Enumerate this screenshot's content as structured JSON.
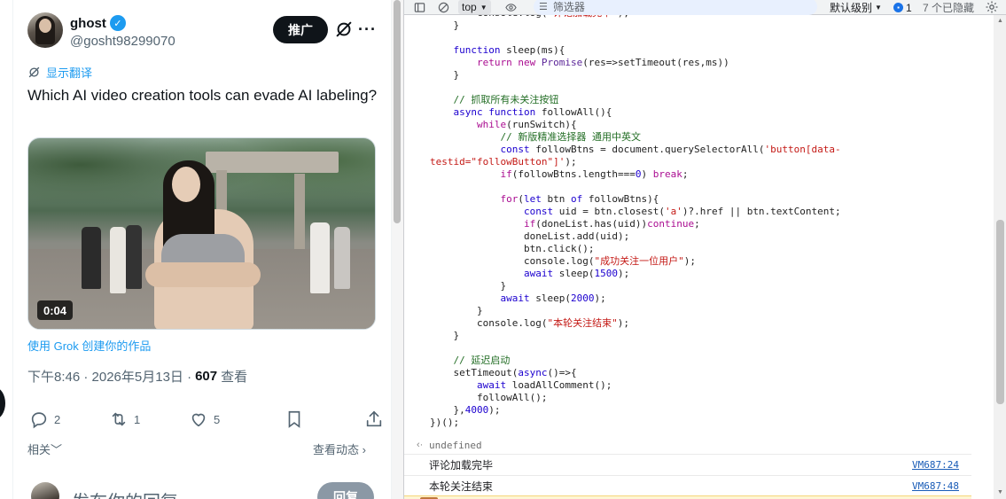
{
  "tweet": {
    "display_name": "ghost",
    "handle": "@gosht98299070",
    "promote_label": "推广",
    "translate_label": "显示翻译",
    "text": "Which AI video creation tools can evade AI labeling?",
    "media": {
      "duration": "0:04"
    },
    "grok_caption": "使用 Grok 创建你的作品",
    "meta": {
      "time": "下午8:46 · 2026年5月13日 · ",
      "views": "607",
      "views_label": "查看"
    },
    "actions": {
      "replies": "2",
      "reposts": "1",
      "likes": "5"
    },
    "related_label": "相关",
    "activity_label": "查看动态",
    "reply": {
      "placeholder": "发布你的回复",
      "button_label": "回复"
    }
  },
  "devtools": {
    "context": "top",
    "filter_placeholder": "筛选器",
    "level_label": "默认级别",
    "issues": "1",
    "hidden": "7 个已隐藏",
    "code_lines": [
      {
        "indent": 2,
        "segments": [
          [
            "plain",
            "console.log("
          ],
          [
            "str",
            "\"评论加载完毕\""
          ],
          [
            "plain",
            ");"
          ]
        ]
      },
      {
        "indent": 1,
        "segments": [
          [
            "plain",
            "}"
          ]
        ]
      },
      {
        "indent": 0,
        "segments": []
      },
      {
        "indent": 1,
        "segments": [
          [
            "kb",
            "function"
          ],
          [
            "plain",
            " sleep(ms){"
          ]
        ]
      },
      {
        "indent": 2,
        "segments": [
          [
            "kw",
            "return"
          ],
          [
            "plain",
            " "
          ],
          [
            "kw",
            "new"
          ],
          [
            "plain",
            " "
          ],
          [
            "ty",
            "Promise"
          ],
          [
            "plain",
            "(res=>setTimeout(res,ms))"
          ]
        ]
      },
      {
        "indent": 1,
        "segments": [
          [
            "plain",
            "}"
          ]
        ]
      },
      {
        "indent": 0,
        "segments": []
      },
      {
        "indent": 1,
        "segments": [
          [
            "cm",
            "// 抓取所有未关注按钮"
          ]
        ]
      },
      {
        "indent": 1,
        "segments": [
          [
            "kb",
            "async"
          ],
          [
            "plain",
            " "
          ],
          [
            "kb",
            "function"
          ],
          [
            "plain",
            " followAll(){"
          ]
        ]
      },
      {
        "indent": 2,
        "segments": [
          [
            "kw",
            "while"
          ],
          [
            "plain",
            "(runSwitch){"
          ]
        ]
      },
      {
        "indent": 3,
        "segments": [
          [
            "cm",
            "// 新版精准选择器 通用中英文"
          ]
        ]
      },
      {
        "indent": 3,
        "segments": [
          [
            "kb",
            "const"
          ],
          [
            "plain",
            " followBtns = document.querySelectorAll("
          ],
          [
            "str",
            "'button[data-"
          ]
        ]
      },
      {
        "indent": 0,
        "segments": [
          [
            "str",
            "testid=\"followButton\"]'"
          ],
          [
            "plain",
            ");"
          ]
        ]
      },
      {
        "indent": 3,
        "segments": [
          [
            "kw",
            "if"
          ],
          [
            "plain",
            "(followBtns.length==="
          ],
          [
            "num",
            "0"
          ],
          [
            "plain",
            ") "
          ],
          [
            "kw",
            "break"
          ],
          [
            "plain",
            ";"
          ]
        ]
      },
      {
        "indent": 0,
        "segments": []
      },
      {
        "indent": 3,
        "segments": [
          [
            "kw",
            "for"
          ],
          [
            "plain",
            "("
          ],
          [
            "kb",
            "let"
          ],
          [
            "plain",
            " btn "
          ],
          [
            "kb",
            "of"
          ],
          [
            "plain",
            " followBtns){"
          ]
        ]
      },
      {
        "indent": 4,
        "segments": [
          [
            "kb",
            "const"
          ],
          [
            "plain",
            " uid = btn.closest("
          ],
          [
            "str",
            "'a'"
          ],
          [
            "plain",
            ")?.href || btn.textContent;"
          ]
        ]
      },
      {
        "indent": 4,
        "segments": [
          [
            "kw",
            "if"
          ],
          [
            "plain",
            "(doneList.has(uid))"
          ],
          [
            "kw",
            "continue"
          ],
          [
            "plain",
            ";"
          ]
        ]
      },
      {
        "indent": 4,
        "segments": [
          [
            "plain",
            "doneList.add(uid);"
          ]
        ]
      },
      {
        "indent": 4,
        "segments": [
          [
            "plain",
            "btn.click();"
          ]
        ]
      },
      {
        "indent": 4,
        "segments": [
          [
            "plain",
            "console.log("
          ],
          [
            "str",
            "\"成功关注一位用户\""
          ],
          [
            "plain",
            ");"
          ]
        ]
      },
      {
        "indent": 4,
        "segments": [
          [
            "kb",
            "await"
          ],
          [
            "plain",
            " sleep("
          ],
          [
            "num",
            "1500"
          ],
          [
            "plain",
            ");"
          ]
        ]
      },
      {
        "indent": 3,
        "segments": [
          [
            "plain",
            "}"
          ]
        ]
      },
      {
        "indent": 3,
        "segments": [
          [
            "kb",
            "await"
          ],
          [
            "plain",
            " sleep("
          ],
          [
            "num",
            "2000"
          ],
          [
            "plain",
            ");"
          ]
        ]
      },
      {
        "indent": 2,
        "segments": [
          [
            "plain",
            "}"
          ]
        ]
      },
      {
        "indent": 2,
        "segments": [
          [
            "plain",
            "console.log("
          ],
          [
            "str",
            "\"本轮关注结束\""
          ],
          [
            "plain",
            ");"
          ]
        ]
      },
      {
        "indent": 1,
        "segments": [
          [
            "plain",
            "}"
          ]
        ]
      },
      {
        "indent": 0,
        "segments": []
      },
      {
        "indent": 1,
        "segments": [
          [
            "cm",
            "// 延迟启动"
          ]
        ]
      },
      {
        "indent": 1,
        "segments": [
          [
            "plain",
            "setTimeout("
          ],
          [
            "kb",
            "async"
          ],
          [
            "plain",
            "()=>{"
          ]
        ]
      },
      {
        "indent": 2,
        "segments": [
          [
            "kb",
            "await"
          ],
          [
            "plain",
            " loadAllComment();"
          ]
        ]
      },
      {
        "indent": 2,
        "segments": [
          [
            "plain",
            "followAll();"
          ]
        ]
      },
      {
        "indent": 1,
        "segments": [
          [
            "plain",
            "},"
          ],
          [
            "num",
            "4000"
          ],
          [
            "plain",
            ");"
          ]
        ]
      },
      {
        "indent": 0,
        "segments": [
          [
            "plain",
            "})();"
          ]
        ]
      }
    ],
    "result": "undefined",
    "logs": [
      {
        "message": "评论加载完毕",
        "source": "VM687:24"
      },
      {
        "message": "本轮关注结束",
        "source": "VM687:48"
      }
    ]
  }
}
